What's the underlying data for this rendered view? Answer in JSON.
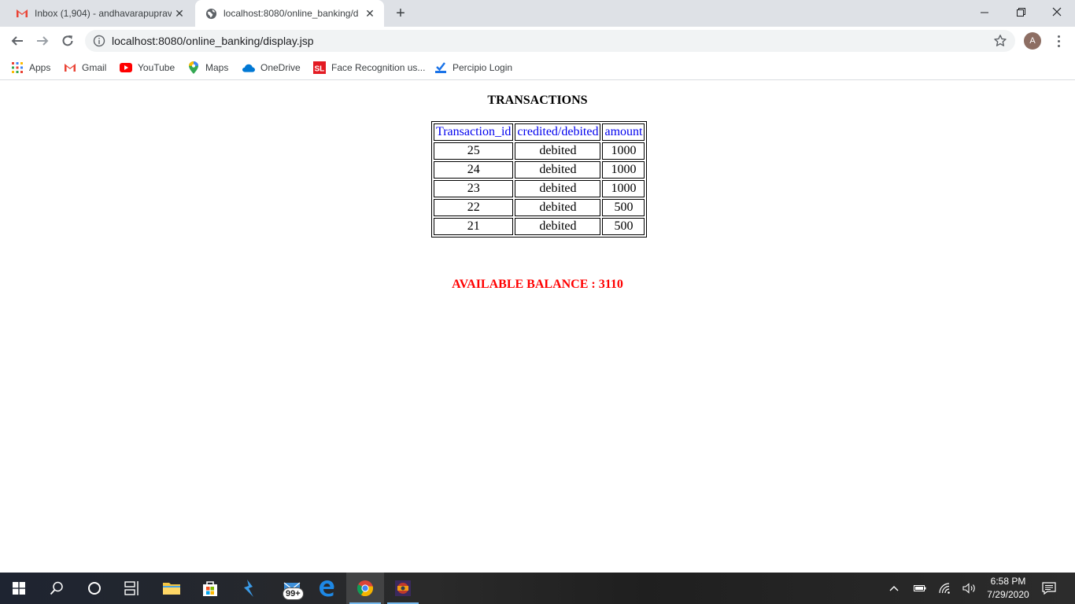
{
  "browser": {
    "tabs": [
      {
        "title": "Inbox (1,904) - andhavarapuprave",
        "icon": "gmail-icon"
      },
      {
        "title": "localhost:8080/online_banking/d",
        "icon": "globe-icon"
      }
    ],
    "url": "localhost:8080/online_banking/display.jsp",
    "profile_initial": "A",
    "bookmarks": [
      {
        "label": "Apps",
        "icon": "apps-grid-icon"
      },
      {
        "label": "Gmail",
        "icon": "gmail-icon"
      },
      {
        "label": "YouTube",
        "icon": "youtube-icon"
      },
      {
        "label": "Maps",
        "icon": "maps-pin-icon"
      },
      {
        "label": "OneDrive",
        "icon": "onedrive-cloud-icon"
      },
      {
        "label": "Face Recognition us...",
        "icon": "sl-icon"
      },
      {
        "label": "Percipio Login",
        "icon": "percipio-icon"
      }
    ]
  },
  "page": {
    "heading": "TRANSACTIONS",
    "columns": [
      "Transaction_id",
      "credited/debited",
      "amount"
    ],
    "rows": [
      [
        "25",
        "debited",
        "1000"
      ],
      [
        "24",
        "debited",
        "1000"
      ],
      [
        "23",
        "debited",
        "1000"
      ],
      [
        "22",
        "debited",
        "500"
      ],
      [
        "21",
        "debited",
        "500"
      ]
    ],
    "balance_text": "AVAILABLE BALANCE : 3110"
  },
  "taskbar": {
    "mail_badge": "99+",
    "time": "6:58 PM",
    "date": "7/29/2020"
  },
  "colors": {
    "header_link": "#0000ee",
    "balance": "#ff0000",
    "tabstrip": "#dee1e6"
  }
}
